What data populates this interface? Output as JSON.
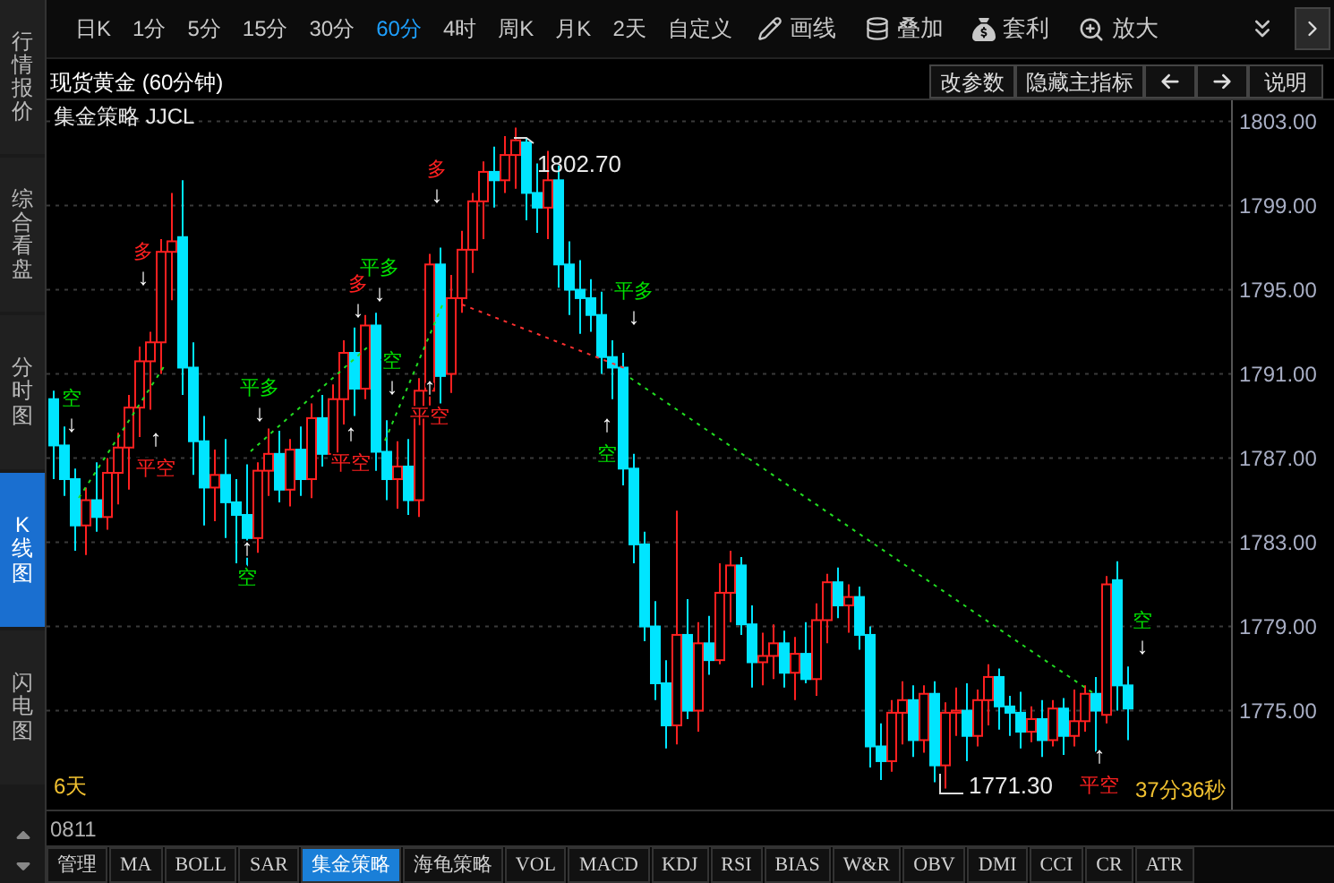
{
  "sidebar": {
    "items": [
      {
        "label": "行情报价",
        "selected": false
      },
      {
        "label": "综合看盘",
        "selected": false
      },
      {
        "label": "分时图",
        "selected": false
      },
      {
        "label": "K线图",
        "selected": true
      },
      {
        "label": "闪电图",
        "selected": false
      }
    ]
  },
  "toolbar": {
    "periods": [
      {
        "label": "日K",
        "selected": false
      },
      {
        "label": "1分",
        "selected": false
      },
      {
        "label": "5分",
        "selected": false
      },
      {
        "label": "15分",
        "selected": false
      },
      {
        "label": "30分",
        "selected": false
      },
      {
        "label": "60分",
        "selected": true
      },
      {
        "label": "4时",
        "selected": false
      },
      {
        "label": "周K",
        "selected": false
      },
      {
        "label": "月K",
        "selected": false
      },
      {
        "label": "2天",
        "selected": false
      },
      {
        "label": "自定义",
        "selected": false
      }
    ],
    "tools": [
      {
        "kind": "draw",
        "label": "画线"
      },
      {
        "kind": "overlay",
        "label": "叠加"
      },
      {
        "kind": "arbitrage",
        "label": "套利"
      },
      {
        "kind": "zoom",
        "label": "放大"
      }
    ]
  },
  "chart_header": {
    "title": "现货黄金 (60分钟)",
    "buttons": [
      "改参数",
      "隐藏主指标"
    ],
    "help_button": "说明"
  },
  "indicator_label": "集金策略 JJCL",
  "chart_data": {
    "type": "candlestick",
    "ylim": [
      1770.3,
      1804
    ],
    "grid": true,
    "yticks": [
      {
        "value": 1803,
        "label": "1803.00"
      },
      {
        "value": 1799,
        "label": "1799.00"
      },
      {
        "value": 1795,
        "label": "1795.00"
      },
      {
        "value": 1791,
        "label": "1791.00"
      },
      {
        "value": 1787,
        "label": "1787.00"
      },
      {
        "value": 1783,
        "label": "1783.00"
      },
      {
        "value": 1779,
        "label": "1779.00"
      },
      {
        "value": 1775,
        "label": "1775.00"
      }
    ],
    "ohlc": [
      [
        1789.8,
        1790.2,
        1786.0,
        1787.6
      ],
      [
        1787.6,
        1788.5,
        1785.2,
        1786.0
      ],
      [
        1786.0,
        1786.5,
        1782.6,
        1783.8
      ],
      [
        1783.8,
        1785.6,
        1782.4,
        1785.0
      ],
      [
        1785.0,
        1786.8,
        1783.5,
        1784.2
      ],
      [
        1784.2,
        1787.0,
        1783.6,
        1786.3
      ],
      [
        1786.3,
        1788.2,
        1784.8,
        1787.5
      ],
      [
        1787.5,
        1790.0,
        1785.5,
        1789.4
      ],
      [
        1789.4,
        1792.3,
        1788.0,
        1791.6
      ],
      [
        1791.6,
        1793.0,
        1789.3,
        1792.5
      ],
      [
        1792.5,
        1797.4,
        1791.0,
        1796.8
      ],
      [
        1796.8,
        1799.6,
        1794.5,
        1797.3
      ],
      [
        1797.5,
        1800.2,
        1790.0,
        1791.3
      ],
      [
        1791.3,
        1792.5,
        1786.2,
        1787.8
      ],
      [
        1787.8,
        1789.0,
        1783.8,
        1785.6
      ],
      [
        1785.6,
        1787.4,
        1784.0,
        1786.2
      ],
      [
        1786.2,
        1787.9,
        1783.2,
        1784.9
      ],
      [
        1784.9,
        1786.0,
        1782.0,
        1784.3
      ],
      [
        1784.3,
        1786.7,
        1781.8,
        1783.2
      ],
      [
        1783.2,
        1786.8,
        1782.5,
        1786.4
      ],
      [
        1786.4,
        1788.4,
        1785.2,
        1787.2
      ],
      [
        1787.2,
        1788.3,
        1784.9,
        1785.5
      ],
      [
        1785.5,
        1787.9,
        1784.7,
        1787.4
      ],
      [
        1787.4,
        1788.5,
        1785.2,
        1786.0
      ],
      [
        1786.0,
        1789.6,
        1785.1,
        1788.9
      ],
      [
        1788.9,
        1790.0,
        1786.6,
        1787.2
      ],
      [
        1787.2,
        1790.5,
        1786.9,
        1789.8
      ],
      [
        1789.8,
        1792.6,
        1788.6,
        1792.0
      ],
      [
        1792.0,
        1793.2,
        1789.0,
        1790.3
      ],
      [
        1790.3,
        1793.8,
        1789.8,
        1793.3
      ],
      [
        1793.3,
        1793.9,
        1786.4,
        1787.3
      ],
      [
        1787.3,
        1788.8,
        1785.0,
        1786.0
      ],
      [
        1786.0,
        1787.8,
        1784.6,
        1786.6
      ],
      [
        1786.6,
        1787.9,
        1784.3,
        1785.0
      ],
      [
        1785.0,
        1790.8,
        1784.2,
        1790.2
      ],
      [
        1790.2,
        1796.7,
        1789.5,
        1796.2
      ],
      [
        1796.2,
        1797.0,
        1789.6,
        1790.9
      ],
      [
        1791.0,
        1795.7,
        1790.1,
        1794.6
      ],
      [
        1794.6,
        1797.8,
        1793.9,
        1796.9
      ],
      [
        1796.9,
        1799.6,
        1795.8,
        1799.2
      ],
      [
        1799.2,
        1801.1,
        1797.4,
        1800.6
      ],
      [
        1800.6,
        1801.8,
        1798.9,
        1800.2
      ],
      [
        1800.2,
        1802.3,
        1799.6,
        1801.4
      ],
      [
        1801.4,
        1802.7,
        1799.8,
        1802.1
      ],
      [
        1802.0,
        1802.2,
        1798.3,
        1799.6
      ],
      [
        1799.6,
        1801.0,
        1797.7,
        1798.9
      ],
      [
        1798.9,
        1801.6,
        1797.4,
        1800.2
      ],
      [
        1800.2,
        1800.9,
        1795.1,
        1796.2
      ],
      [
        1796.2,
        1797.3,
        1793.8,
        1795.0
      ],
      [
        1795.0,
        1796.4,
        1792.9,
        1794.6
      ],
      [
        1794.6,
        1795.5,
        1793.0,
        1793.8
      ],
      [
        1793.8,
        1794.9,
        1791.0,
        1791.8
      ],
      [
        1791.8,
        1792.6,
        1789.8,
        1791.3
      ],
      [
        1791.3,
        1792.0,
        1785.7,
        1786.5
      ],
      [
        1786.5,
        1787.2,
        1782.0,
        1782.9
      ],
      [
        1782.9,
        1783.5,
        1778.3,
        1779.0
      ],
      [
        1779.0,
        1780.2,
        1775.5,
        1776.3
      ],
      [
        1776.3,
        1777.4,
        1773.2,
        1774.3
      ],
      [
        1774.3,
        1784.5,
        1773.4,
        1778.6
      ],
      [
        1778.6,
        1780.3,
        1774.6,
        1775.0
      ],
      [
        1775.0,
        1779.2,
        1774.0,
        1778.2
      ],
      [
        1778.2,
        1779.5,
        1776.7,
        1777.4
      ],
      [
        1777.4,
        1782.0,
        1777.2,
        1780.6
      ],
      [
        1780.6,
        1782.6,
        1779.2,
        1781.9
      ],
      [
        1781.9,
        1782.3,
        1778.6,
        1779.1
      ],
      [
        1779.1,
        1780.0,
        1776.1,
        1777.3
      ],
      [
        1777.3,
        1778.7,
        1776.2,
        1777.6
      ],
      [
        1777.6,
        1779.1,
        1776.5,
        1778.2
      ],
      [
        1778.2,
        1778.8,
        1776.1,
        1776.8
      ],
      [
        1776.8,
        1778.5,
        1775.5,
        1777.7
      ],
      [
        1777.7,
        1779.2,
        1776.3,
        1776.5
      ],
      [
        1776.5,
        1780.1,
        1775.7,
        1779.3
      ],
      [
        1779.3,
        1781.5,
        1778.2,
        1781.1
      ],
      [
        1781.1,
        1781.8,
        1779.4,
        1780.0
      ],
      [
        1780.0,
        1781.0,
        1778.7,
        1780.4
      ],
      [
        1780.4,
        1780.9,
        1777.9,
        1778.6
      ],
      [
        1778.6,
        1779.0,
        1772.3,
        1773.3
      ],
      [
        1773.3,
        1774.4,
        1771.7,
        1772.6
      ],
      [
        1772.6,
        1775.5,
        1772.1,
        1774.9
      ],
      [
        1774.9,
        1776.4,
        1773.4,
        1775.5
      ],
      [
        1775.5,
        1776.2,
        1772.8,
        1773.6
      ],
      [
        1773.6,
        1776.2,
        1773.0,
        1775.8
      ],
      [
        1775.8,
        1776.4,
        1771.6,
        1772.4
      ],
      [
        1772.4,
        1775.4,
        1771.3,
        1774.9
      ],
      [
        1774.9,
        1776.1,
        1773.8,
        1775.0
      ],
      [
        1775.0,
        1776.3,
        1772.6,
        1773.8
      ],
      [
        1773.8,
        1776.0,
        1773.3,
        1775.5
      ],
      [
        1775.5,
        1777.2,
        1774.3,
        1776.6
      ],
      [
        1776.6,
        1777.0,
        1774.1,
        1775.2
      ],
      [
        1775.2,
        1775.7,
        1773.8,
        1774.9
      ],
      [
        1774.9,
        1775.9,
        1773.2,
        1774.0
      ],
      [
        1774.0,
        1775.2,
        1773.5,
        1774.6
      ],
      [
        1774.6,
        1775.5,
        1772.8,
        1773.6
      ],
      [
        1773.6,
        1775.5,
        1773.3,
        1775.1
      ],
      [
        1775.1,
        1775.6,
        1772.9,
        1773.8
      ],
      [
        1773.8,
        1776.0,
        1773.3,
        1774.5
      ],
      [
        1774.5,
        1776.2,
        1774.0,
        1775.8
      ],
      [
        1775.8,
        1776.6,
        1773.0,
        1775.0
      ],
      [
        1774.8,
        1781.4,
        1774.4,
        1781.0
      ],
      [
        1781.2,
        1782.1,
        1775.0,
        1776.2
      ],
      [
        1776.2,
        1777.1,
        1773.6,
        1775.1
      ]
    ]
  },
  "high_label": "1802.70",
  "low_label": "1771.30",
  "span_label": "6天",
  "countdown": "37分36秒",
  "signals": [
    {
      "label": "空",
      "color": "#00e000",
      "kind": "down",
      "arrow": "↓"
    },
    {
      "label": "多",
      "color": "#ff2020",
      "kind": "down",
      "arrow": "↓"
    },
    {
      "label": "平空",
      "color": "#ff2020",
      "kind": "up",
      "arrow": "↑"
    },
    {
      "label": "平多",
      "color": "#00e000",
      "kind": "down",
      "arrow": "↓"
    },
    {
      "label": "空",
      "color": "#00e000",
      "kind": "up",
      "arrow": "↑"
    },
    {
      "label": "平多",
      "color": "#00e000",
      "kind": "down",
      "arrow": "↓"
    },
    {
      "label": "多",
      "color": "#ff2020",
      "kind": "down",
      "arrow": "↓"
    },
    {
      "label": "空",
      "color": "#00e000",
      "kind": "down",
      "arrow": "↓"
    },
    {
      "label": "平空",
      "color": "#ff2020",
      "kind": "up",
      "arrow": "↑"
    },
    {
      "label": "多",
      "color": "#ff2020",
      "kind": "down",
      "arrow": "↓"
    },
    {
      "label": "平空",
      "color": "#ff2020",
      "kind": "up",
      "arrow": "↑"
    },
    {
      "label": "平多",
      "color": "#00e000",
      "kind": "down",
      "arrow": "↓"
    },
    {
      "label": "空",
      "color": "#00e000",
      "kind": "up",
      "arrow": "↑"
    },
    {
      "label": "平空",
      "color": "#ff2020",
      "kind": "up",
      "arrow": "↑"
    },
    {
      "label": "空",
      "color": "#00e000",
      "kind": "down",
      "arrow": "↓"
    }
  ],
  "code": "0811",
  "indicator_tabs": [
    {
      "label": "管理",
      "selected": false
    },
    {
      "label": "MA",
      "selected": false
    },
    {
      "label": "BOLL",
      "selected": false
    },
    {
      "label": "SAR",
      "selected": false
    },
    {
      "label": "集金策略",
      "selected": true
    },
    {
      "label": "海龟策略",
      "selected": false
    },
    {
      "label": "VOL",
      "selected": false
    },
    {
      "label": "MACD",
      "selected": false
    },
    {
      "label": "KDJ",
      "selected": false
    },
    {
      "label": "RSI",
      "selected": false
    },
    {
      "label": "BIAS",
      "selected": false
    },
    {
      "label": "W&R",
      "selected": false
    },
    {
      "label": "OBV",
      "selected": false
    },
    {
      "label": "DMI",
      "selected": false
    },
    {
      "label": "CCI",
      "selected": false
    },
    {
      "label": "CR",
      "selected": false
    },
    {
      "label": "ATR",
      "selected": false
    }
  ]
}
